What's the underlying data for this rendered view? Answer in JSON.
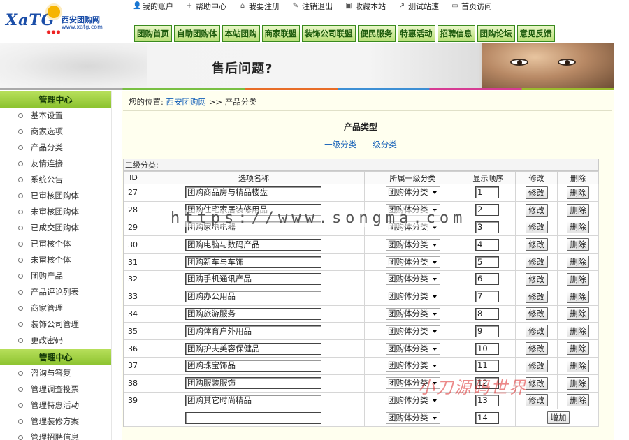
{
  "logo": {
    "mark": "XaTG",
    "cn": "西安团购网",
    "url": "www.xatg.com"
  },
  "topnav": [
    {
      "icon": "user-icon",
      "glyph": "👤",
      "label": "我的账户"
    },
    {
      "icon": "plus-icon",
      "glyph": "+",
      "label": "帮助中心"
    },
    {
      "icon": "house-icon",
      "glyph": "⌂",
      "label": "我要注册"
    },
    {
      "icon": "pencil-icon",
      "glyph": "✎",
      "label": "注销退出"
    },
    {
      "icon": "bookmark-icon",
      "glyph": "▣",
      "label": "收藏本站"
    },
    {
      "icon": "speed-icon",
      "glyph": "↗",
      "label": "测试站速"
    },
    {
      "icon": "home-icon",
      "glyph": "▭",
      "label": "首页访问"
    }
  ],
  "mainnav": [
    "团购首页",
    "自助团购体",
    "本站团购",
    "商家联盟",
    "装饰公司联盟",
    "便民服务",
    "特惠活动",
    "招聘信息",
    "团购论坛",
    "意见反馈"
  ],
  "banner": {
    "title": "售后问题?"
  },
  "sidebar": {
    "group1": {
      "title": "管理中心",
      "items": [
        "基本设置",
        "商家选项",
        "产品分类",
        "友情连接",
        "系统公告",
        "已审核团购体",
        "未审核团购体",
        "已成交团购体",
        "已审核个体",
        "未审核个体",
        "团购产品",
        "产品评论列表",
        "商家管理",
        "装饰公司管理",
        "更改密码"
      ]
    },
    "group2": {
      "title": "管理中心",
      "items": [
        "咨询与答复",
        "管理调查投票",
        "管理特惠活动",
        "管理装修方案",
        "管理招聘信息"
      ]
    }
  },
  "breadcrumb": {
    "prefix": "您的位置:",
    "home": "西安团购网",
    "sep": ">>",
    "current": "产品分类"
  },
  "page": {
    "title": "产品类型",
    "link1": "一级分类",
    "link2": "二级分类"
  },
  "grid": {
    "caption": "二级分类:",
    "headers": [
      "ID",
      "选项名称",
      "所属一级分类",
      "显示顺序",
      "修改",
      "删除"
    ],
    "rows": [
      {
        "id": "27",
        "name": "团购商品房与精品楼盘",
        "cat": "团购体分类",
        "order": "1"
      },
      {
        "id": "28",
        "name": "团购住宅家居装修用品",
        "cat": "团购体分类",
        "order": "2"
      },
      {
        "id": "29",
        "name": "团购家电电器",
        "cat": "团购体分类",
        "order": "3"
      },
      {
        "id": "30",
        "name": "团购电脑与数码产品",
        "cat": "团购体分类",
        "order": "4"
      },
      {
        "id": "31",
        "name": "团购新车与车饰",
        "cat": "团购体分类",
        "order": "5"
      },
      {
        "id": "32",
        "name": "团购手机通讯产品",
        "cat": "团购体分类",
        "order": "6"
      },
      {
        "id": "33",
        "name": "团购办公用品",
        "cat": "团购体分类",
        "order": "7"
      },
      {
        "id": "34",
        "name": "团购旅游服务",
        "cat": "团购体分类",
        "order": "8"
      },
      {
        "id": "35",
        "name": "团购体育户外用品",
        "cat": "团购体分类",
        "order": "9"
      },
      {
        "id": "36",
        "name": "团购护夫美容保健品",
        "cat": "团购体分类",
        "order": "10"
      },
      {
        "id": "37",
        "name": "团购珠宝饰品",
        "cat": "团购体分类",
        "order": "11"
      },
      {
        "id": "38",
        "name": "团购服装服饰",
        "cat": "团购体分类",
        "order": "12"
      },
      {
        "id": "39",
        "name": "团购其它时尚精品",
        "cat": "团购体分类",
        "order": "13"
      }
    ],
    "new_row": {
      "name": "",
      "cat": "团购体分类",
      "order": "14"
    },
    "edit_label": "修改",
    "delete_label": "删除",
    "add_label": "增加"
  },
  "watermark": {
    "url": "https://www.songma.com",
    "brand": "小刀源码世界"
  }
}
